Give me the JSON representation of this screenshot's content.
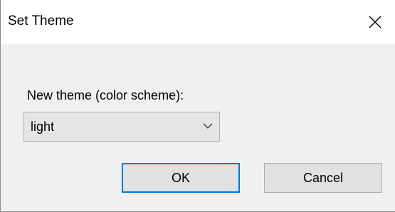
{
  "window": {
    "title": "Set Theme",
    "close_icon": "close-icon"
  },
  "form": {
    "label": "New theme (color scheme):",
    "theme_select": {
      "selected": "light",
      "arrow_icon": "chevron-down-icon"
    }
  },
  "buttons": {
    "ok_label": "OK",
    "cancel_label": "Cancel"
  },
  "colors": {
    "focus_border": "#0078d7",
    "dialog_bg": "#f0f0f0",
    "titlebar_bg": "#ffffff"
  }
}
